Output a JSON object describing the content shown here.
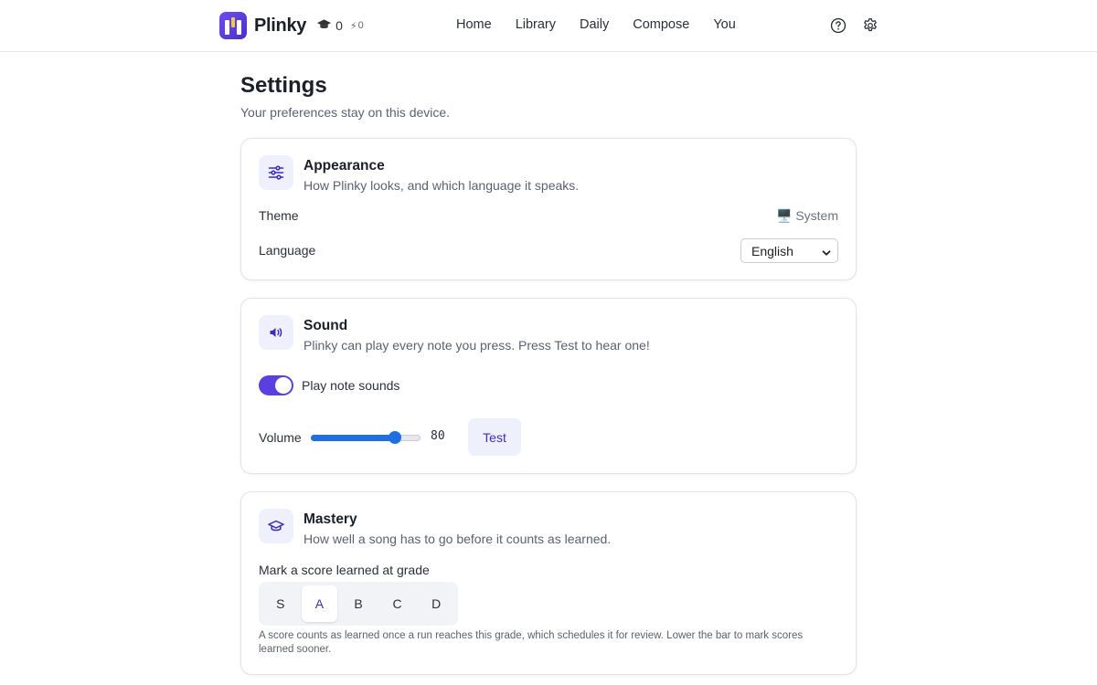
{
  "header": {
    "brand": "Plinky",
    "learned_count": "0",
    "streak_count": "0",
    "nav": [
      "Home",
      "Library",
      "Daily",
      "Compose",
      "You"
    ],
    "icons": [
      "help-circle-icon",
      "gear-icon"
    ]
  },
  "page": {
    "title": "Settings",
    "subtitle": "Your preferences stay on this device."
  },
  "appearance": {
    "title": "Appearance",
    "description": "How Plinky looks, and which language it speaks.",
    "icon": "sliders-icon",
    "theme_label": "Theme",
    "theme_value": "🖥️ System",
    "language_label": "Language",
    "language_value": "English"
  },
  "sound": {
    "title": "Sound",
    "description": "Plinky can play every note you press. Press Test to hear one!",
    "icon": "speaker-icon",
    "toggle_label": "Play note sounds",
    "toggle_on": true,
    "volume_label": "Volume",
    "volume_value": "80",
    "volume_max": 100,
    "test_label": "Test"
  },
  "mastery": {
    "title": "Mastery",
    "description": "How well a song has to go before it counts as learned.",
    "icon": "graduation-cap-icon",
    "grade_label": "Mark a score learned at grade",
    "grades": [
      "S",
      "A",
      "B",
      "C",
      "D"
    ],
    "selected_grade": "A",
    "note": "A score counts as learned once a run reaches this grade, which schedules it for review. Lower the bar to mark scores learned sooner."
  },
  "colors": {
    "accent": "#5b3fe0",
    "accent_text": "#3b2fb5",
    "slider": "#1f6fe0",
    "icon_bg": "#eef0fb"
  }
}
